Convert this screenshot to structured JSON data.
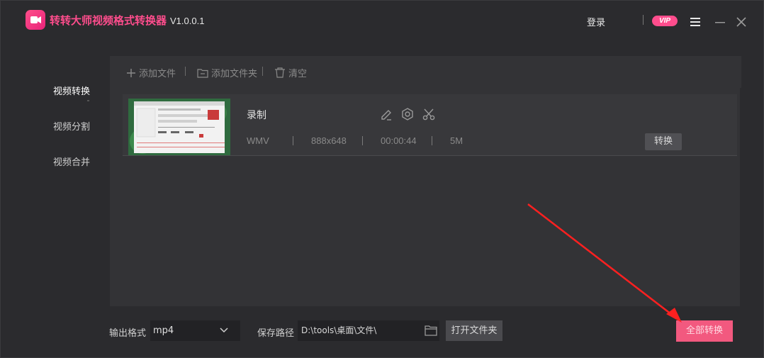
{
  "app": {
    "title": "转转大师视频格式转换器",
    "version": "V1.0.0.1",
    "login_label": "登录",
    "vip_label": "VIP",
    "accent_color": "#ff4d8d"
  },
  "sidebar": {
    "items": [
      {
        "label": "视频转换",
        "active": true
      },
      {
        "label": "视频分割",
        "active": false
      },
      {
        "label": "视频合并",
        "active": false
      }
    ]
  },
  "toolbar": {
    "add_file": "添加文件",
    "add_folder": "添加文件夹",
    "clear": "清空"
  },
  "files": [
    {
      "name": "录制",
      "format": "WMV",
      "resolution": "888x648",
      "duration": "00:00:44",
      "size": "5M",
      "convert_label": "转换"
    }
  ],
  "bottom": {
    "output_format_label": "输出格式",
    "output_format_value": "mp4",
    "save_path_label": "保存路径",
    "save_path_value": "D:\\tools\\桌面\\文件\\",
    "open_folder_label": "打开文件夹",
    "convert_all_label": "全部转换"
  },
  "icons": {
    "logo": "video-camera-icon",
    "menu": "hamburger-menu-icon",
    "minimize": "minimize-icon",
    "close": "close-icon",
    "edit": "pencil-icon",
    "settings": "settings-icon",
    "cut": "scissors-icon",
    "folder": "folder-icon"
  }
}
